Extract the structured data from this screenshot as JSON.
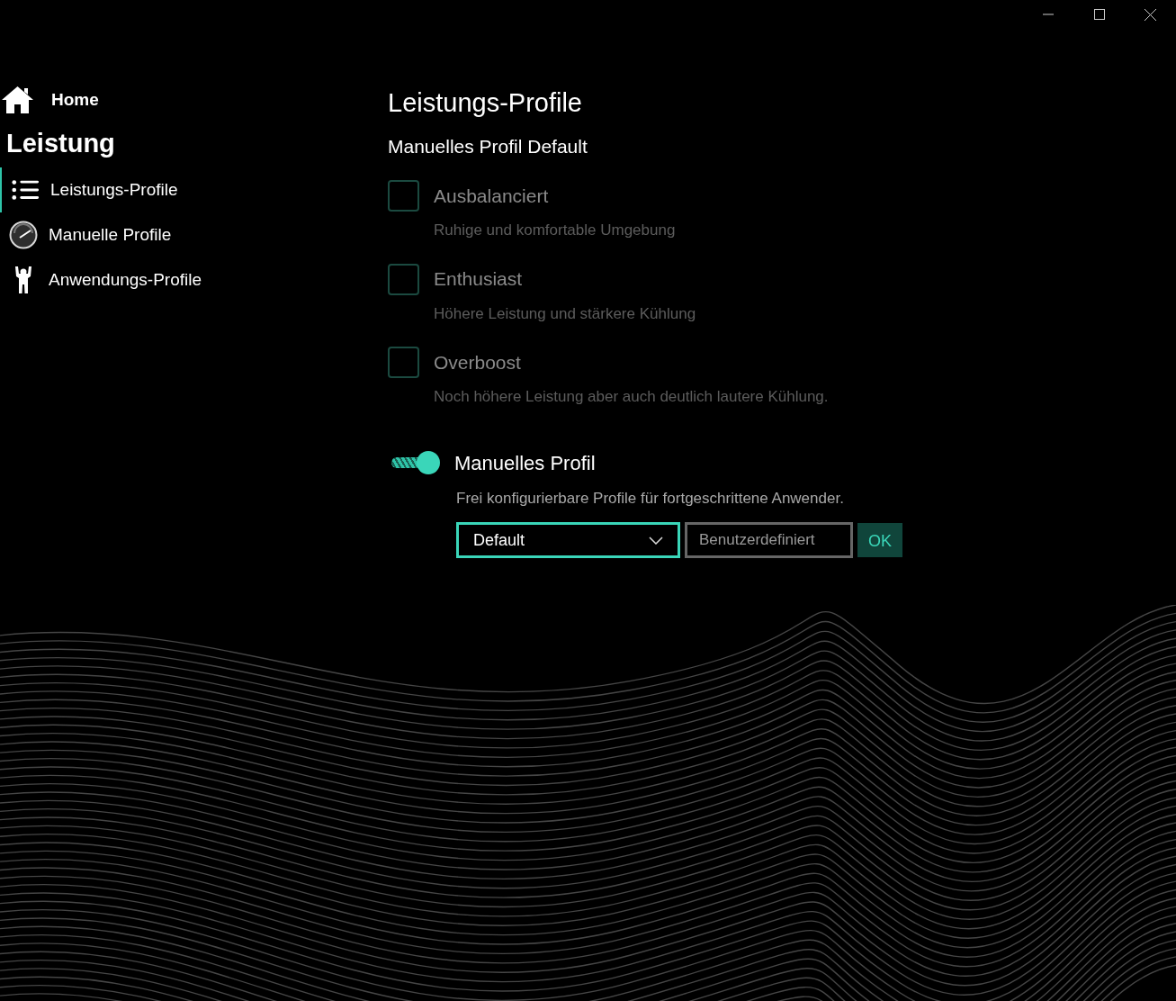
{
  "nav": {
    "home": {
      "label": "Home"
    },
    "section": "Leistung",
    "items": [
      {
        "label": "Leistungs-Profile",
        "kind": "list",
        "selected": true
      },
      {
        "label": "Manuelle Profile",
        "kind": "gauge",
        "selected": false
      },
      {
        "label": "Anwendungs-Profile",
        "kind": "person",
        "selected": false
      }
    ]
  },
  "page": {
    "title": "Leistungs-Profile",
    "subtitle": "Manuelles Profil Default",
    "profiles": [
      {
        "label": "Ausbalanciert",
        "description": "Ruhige und komfortable Umgebung",
        "checked": false
      },
      {
        "label": "Enthusiast",
        "description": "Höhere Leistung und stärkere Kühlung",
        "checked": false
      },
      {
        "label": "Overboost",
        "description": "Noch höhere Leistung aber auch deutlich lautere Kühlung.",
        "checked": false
      }
    ],
    "manual": {
      "on": true,
      "label": "Manuelles Profil",
      "description": "Frei konfigurierbare Profile für fortgeschrittene Anwender.",
      "dropdown": {
        "value": "Default"
      },
      "name_field": {
        "placeholder": "Benutzerdefiniert"
      },
      "ok_button": "OK"
    }
  }
}
